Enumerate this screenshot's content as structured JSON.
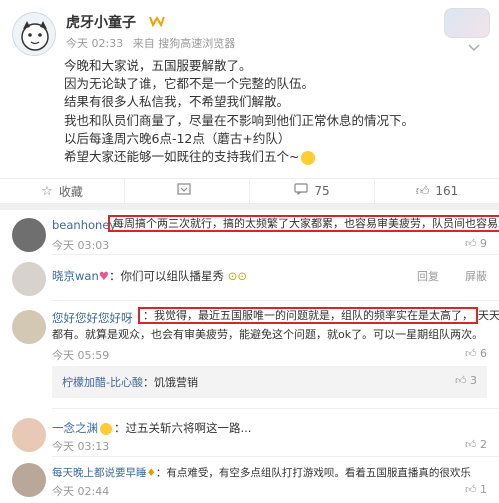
{
  "post": {
    "username": "虎牙小童子",
    "vip_badge": "VIP",
    "meta_time": "今天 02:33",
    "meta_source": "来自 搜狗高速浏览器",
    "dropdown_icon": "chevron-down-icon",
    "lines": [
      "今晚和大家说，五国服要解散了。",
      "因为无论缺了谁，它都不是一个完整的队伍。",
      "结果有很多人私信我，不希望我们解散。",
      "我也和队员们商量了，尽量在不影响到他们正常休息的情况下。",
      "以后每逢周六晚6点-12点（蘑古+约队）",
      "希望大家还能够一如既往的支持我们五个~"
    ]
  },
  "actions": {
    "favorite": "收藏",
    "repost_count": "",
    "comment_count": "75",
    "like_count": "161"
  },
  "comments": [
    {
      "name": "beanhoney",
      "text": "每周搞个两三次就行，搞的太频繁了大家都累，也容易审美疲劳，队员间也容易矛盾",
      "time": "今天 03:03",
      "likes": "9"
    },
    {
      "name": "晓京wan",
      "text": "：你们可以组队播星秀",
      "time": "今天 02:43",
      "likes": "屏蔽",
      "reply": "回复"
    },
    {
      "name": "您好您好您好呀",
      "text_boxed": "：我觉得，最近五国服唯一的问题就是，组队的频率实在是太高了，",
      "text_tail": "天天晚上",
      "text_line2": "都有。就算是观众，也会有审美疲劳，能避免这个问题，就ok了。可以一星期组队两次。",
      "time": "今天 05:59",
      "likes": "6"
    },
    {
      "name": "柠檬加醋-比心酸",
      "text": "：饥饿营销",
      "likes": "3"
    },
    {
      "name": "一念之渊",
      "text": "：过五关斩六将啊这一路...",
      "time": "今天 03:13",
      "likes": "2"
    },
    {
      "name": "每天晚上都说要早睡",
      "text": "：有点难受，有空多点组队打打游戏呗。看着五国服直播真的很欢乐",
      "time": "今天 02:44",
      "likes": "1"
    }
  ]
}
